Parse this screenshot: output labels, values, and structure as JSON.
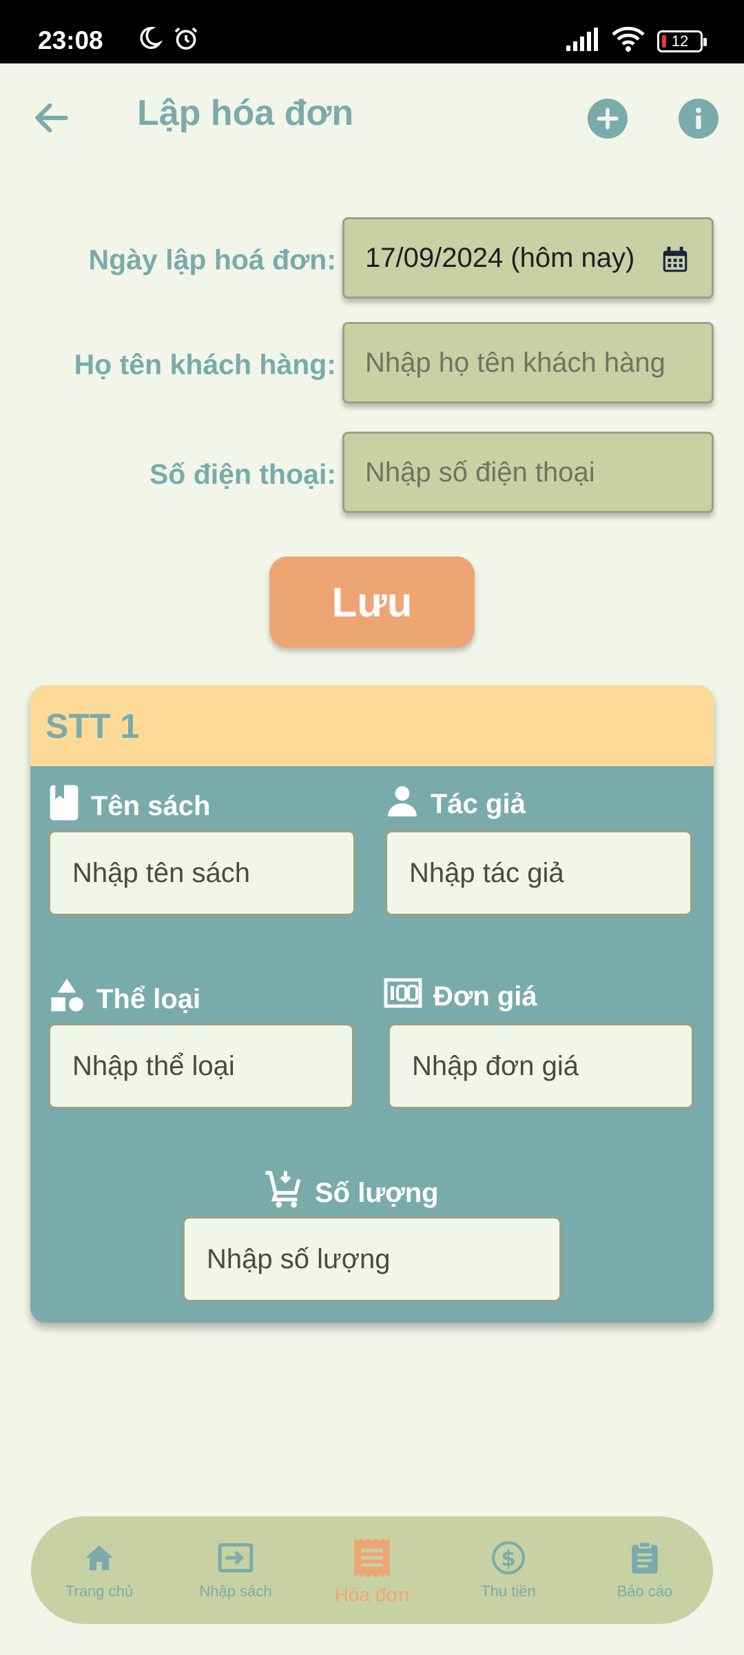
{
  "status_bar": {
    "time": "23:08",
    "battery": "12"
  },
  "header": {
    "title": "Lập hóa đơn"
  },
  "form": {
    "date_label": "Ngày lập hoá đơn:",
    "date_value": "17/09/2024 (hôm nay)",
    "name_label": "Họ tên khách hàng:",
    "name_placeholder": "Nhập họ tên khách hàng",
    "phone_label": "Số điện thoại:",
    "phone_placeholder": "Nhập số điện thoại"
  },
  "save_button": "Lưu",
  "item_card": {
    "title": "STT 1",
    "book_title": {
      "label": "Tên sách",
      "placeholder": "Nhập tên sách"
    },
    "author": {
      "label": "Tác giả",
      "placeholder": "Nhập tác giả"
    },
    "genre": {
      "label": "Thể loại",
      "placeholder": "Nhập thể loại"
    },
    "price": {
      "label": "Đơn giá",
      "placeholder": "Nhập đơn giá"
    },
    "quantity": {
      "label": "Số lượng",
      "placeholder": "Nhập số lượng"
    }
  },
  "bottom_nav": {
    "items": [
      {
        "label": "Trang chủ",
        "icon": "home-icon"
      },
      {
        "label": "Nhập sách",
        "icon": "import-icon"
      },
      {
        "label": "Hóa đơn",
        "icon": "receipt-icon",
        "active": true
      },
      {
        "label": "Thu tiền",
        "icon": "dollar-icon"
      },
      {
        "label": "Báo cáo",
        "icon": "clipboard-icon"
      }
    ]
  },
  "colors": {
    "background": "#f1f6e9",
    "accent_teal": "#7aabab",
    "field_olive": "#c8d1a3",
    "save_orange": "#eea574",
    "card_header_yellow": "#fddb97"
  }
}
